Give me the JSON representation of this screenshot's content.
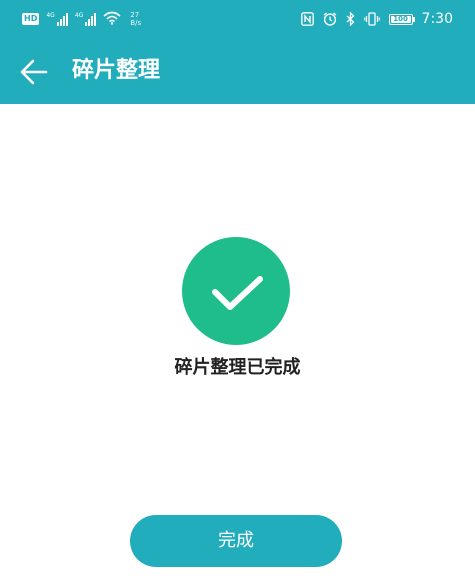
{
  "colors": {
    "accent": "#22adbd",
    "success": "#1fbd8b"
  },
  "status_bar": {
    "hd_badge": "HD",
    "signal_1_label": "4G",
    "signal_2_label": "4G",
    "net_speed_value": "27",
    "net_speed_unit": "B/s",
    "battery_level": "100",
    "time": "7:30",
    "icons": [
      "nfc-icon",
      "alarm-icon",
      "bluetooth-icon",
      "vibrate-icon",
      "battery-icon"
    ]
  },
  "app_bar": {
    "back_icon": "arrow-left-icon",
    "title": "碎片整理"
  },
  "main": {
    "success_icon": "check-circle-icon",
    "status_text": "碎片整理已完成",
    "done_button": "完成"
  }
}
